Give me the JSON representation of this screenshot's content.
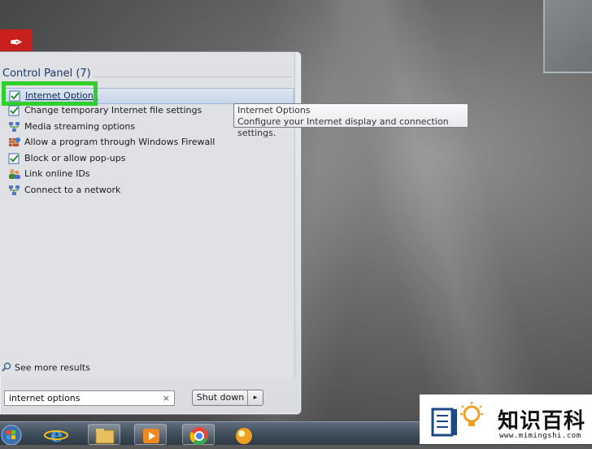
{
  "start_menu": {
    "section_title": "Control Panel (7)",
    "results": [
      {
        "label": "Internet Options",
        "icon": "internet-options-icon"
      },
      {
        "label": "Change temporary Internet file settings",
        "icon": "internet-options-icon"
      },
      {
        "label": "Media streaming options",
        "icon": "network-icon"
      },
      {
        "label": "Allow a program through Windows Firewall",
        "icon": "firewall-icon"
      },
      {
        "label": "Block or allow pop-ups",
        "icon": "internet-options-icon"
      },
      {
        "label": "Link online IDs",
        "icon": "users-icon"
      },
      {
        "label": "Connect to a network",
        "icon": "network-icon"
      }
    ],
    "see_more": "See more results",
    "search_value": "internet options",
    "search_clear": "×",
    "shutdown_label": "Shut down",
    "shutdown_arrow": "▸"
  },
  "tooltip": {
    "title": "Internet Options",
    "description": "Configure your Internet display and connection settings."
  },
  "watermark": {
    "text": "知识百科",
    "url": "www.mimingshi.com"
  },
  "colors": {
    "highlight": "#2ed12a",
    "pdf_icon": "#c8201e"
  }
}
